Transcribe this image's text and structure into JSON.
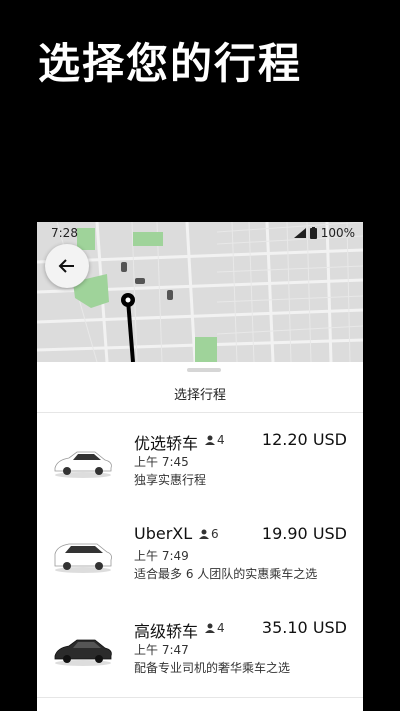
{
  "hero": {
    "title": "选择您的行程"
  },
  "status": {
    "time": "7:28",
    "battery": "100%"
  },
  "sheet": {
    "title": "选择行程"
  },
  "options": [
    {
      "name": "优选轿车",
      "seats": "4",
      "price": "12.20 USD",
      "time": "上午 7:45",
      "desc": "独享实惠行程",
      "car_color": "#ffffff"
    },
    {
      "name": "UberXL",
      "seats": "6",
      "price": "19.90 USD",
      "time": "上午 7:49",
      "desc": "适合最多 6 人团队的实惠乘车之选",
      "car_color": "#ffffff"
    },
    {
      "name": "高级轿车",
      "seats": "4",
      "price": "35.10 USD",
      "time": "上午 7:47",
      "desc": "配备专业司机的奢华乘车之选",
      "car_color": "#2b2b2b"
    }
  ],
  "colors": {
    "map_bg": "#dcdcdc",
    "park": "#9fd39a",
    "route": "#000000"
  }
}
